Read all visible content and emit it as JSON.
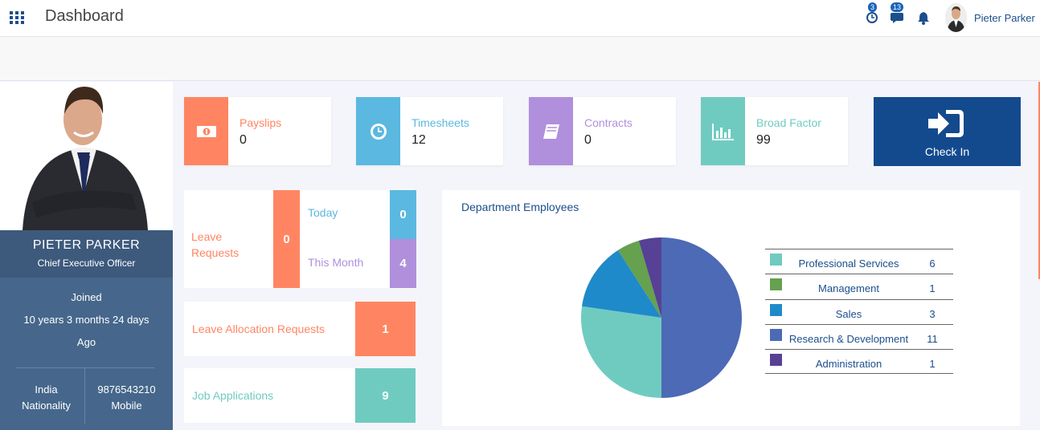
{
  "header": {
    "title": "Dashboard",
    "clock_badge": "3",
    "chat_badge": "13",
    "user_name": "Pieter Parker"
  },
  "profile": {
    "name": "PIETER PARKER",
    "role": "Chief Executive Officer",
    "joined_label": "Joined",
    "joined_duration": "10 years 3 months 24 days",
    "joined_suffix": "Ago",
    "nationality_value": "India",
    "nationality_label": "Nationality",
    "mobile_value": "9876543210",
    "mobile_label": "Mobile"
  },
  "stats": [
    {
      "label": "Payslips",
      "value": "0",
      "color": "#ff8562",
      "icon": "money-icon"
    },
    {
      "label": "Timesheets",
      "value": "12",
      "color": "#5bb8e0",
      "icon": "clock-icon"
    },
    {
      "label": "Contracts",
      "value": "0",
      "color": "#b08fdc",
      "icon": "book-icon"
    },
    {
      "label": "Broad Factor",
      "value": "99",
      "color": "#6fcbc0",
      "icon": "bar-chart-icon"
    }
  ],
  "checkin": {
    "label": "Check In",
    "icon": "sign-in-icon"
  },
  "leave": {
    "label": "Leave Requests",
    "count": "0",
    "today_label": "Today",
    "today_value": "0",
    "month_label": "This Month",
    "month_value": "4"
  },
  "allocation": {
    "label": "Leave Allocation Requests",
    "value": "1"
  },
  "jobs": {
    "label": "Job Applications",
    "value": "9"
  },
  "department": {
    "title": "Department Employees"
  },
  "chart_data": {
    "type": "pie",
    "title": "Department Employees",
    "slices": [
      {
        "name": "Professional Services",
        "value": 6,
        "color": "#6fcbc0"
      },
      {
        "name": "Management",
        "value": 1,
        "color": "#65a14e"
      },
      {
        "name": "Sales",
        "value": 3,
        "color": "#1f8ac9"
      },
      {
        "name": "Research & Development",
        "value": 11,
        "color": "#4c6ab5"
      },
      {
        "name": "Administration",
        "value": 1,
        "color": "#564195"
      }
    ],
    "legend": "right"
  }
}
